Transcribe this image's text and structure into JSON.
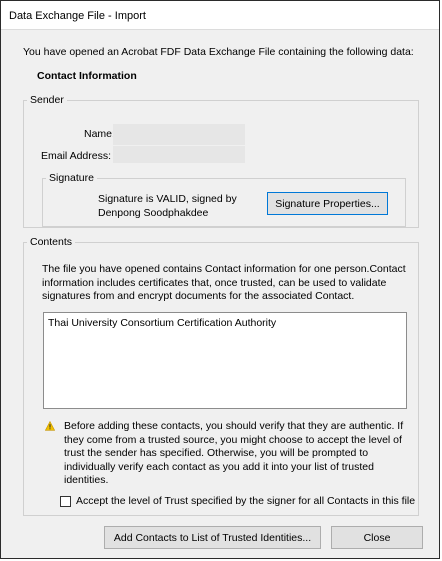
{
  "window": {
    "title": "Data Exchange File - Import"
  },
  "intro_text": "You have opened an Acrobat FDF Data Exchange File containing the following data:",
  "contact_heading": "Contact Information",
  "sender": {
    "legend": "Sender",
    "name_label": "Name:",
    "email_label": "Email Address:",
    "signature": {
      "legend": "Signature",
      "status_line1": "Signature is VALID, signed by",
      "status_line2": "Denpong Soodphakdee",
      "properties_button": "Signature Properties..."
    }
  },
  "contents": {
    "legend": "Contents",
    "description": "The file you have opened contains Contact information for one person.Contact information includes certificates that, once trusted, can be used to validate signatures from and encrypt documents for the associated Contact.",
    "list_items": [
      "Thai University Consortium Certification Authority"
    ],
    "warning_icon": "warning-triangle-icon",
    "warning_text": "Before adding these contacts, you should verify that they are authentic. If they come from a trusted source, you might choose to accept the level of trust the sender has specified. Otherwise, you will be prompted to individually verify each contact as you add it into your list of trusted identities.",
    "accept_checkbox_label": "Accept the level of Trust specified by the signer for all Contacts in this file",
    "accept_checked": false
  },
  "buttons": {
    "add_contacts": "Add Contacts to List of Trusted Identities...",
    "close": "Close"
  },
  "colors": {
    "dialog_background": "#f0f0f0",
    "focus_border": "#0078d7",
    "warning_icon": "#f0c000"
  }
}
